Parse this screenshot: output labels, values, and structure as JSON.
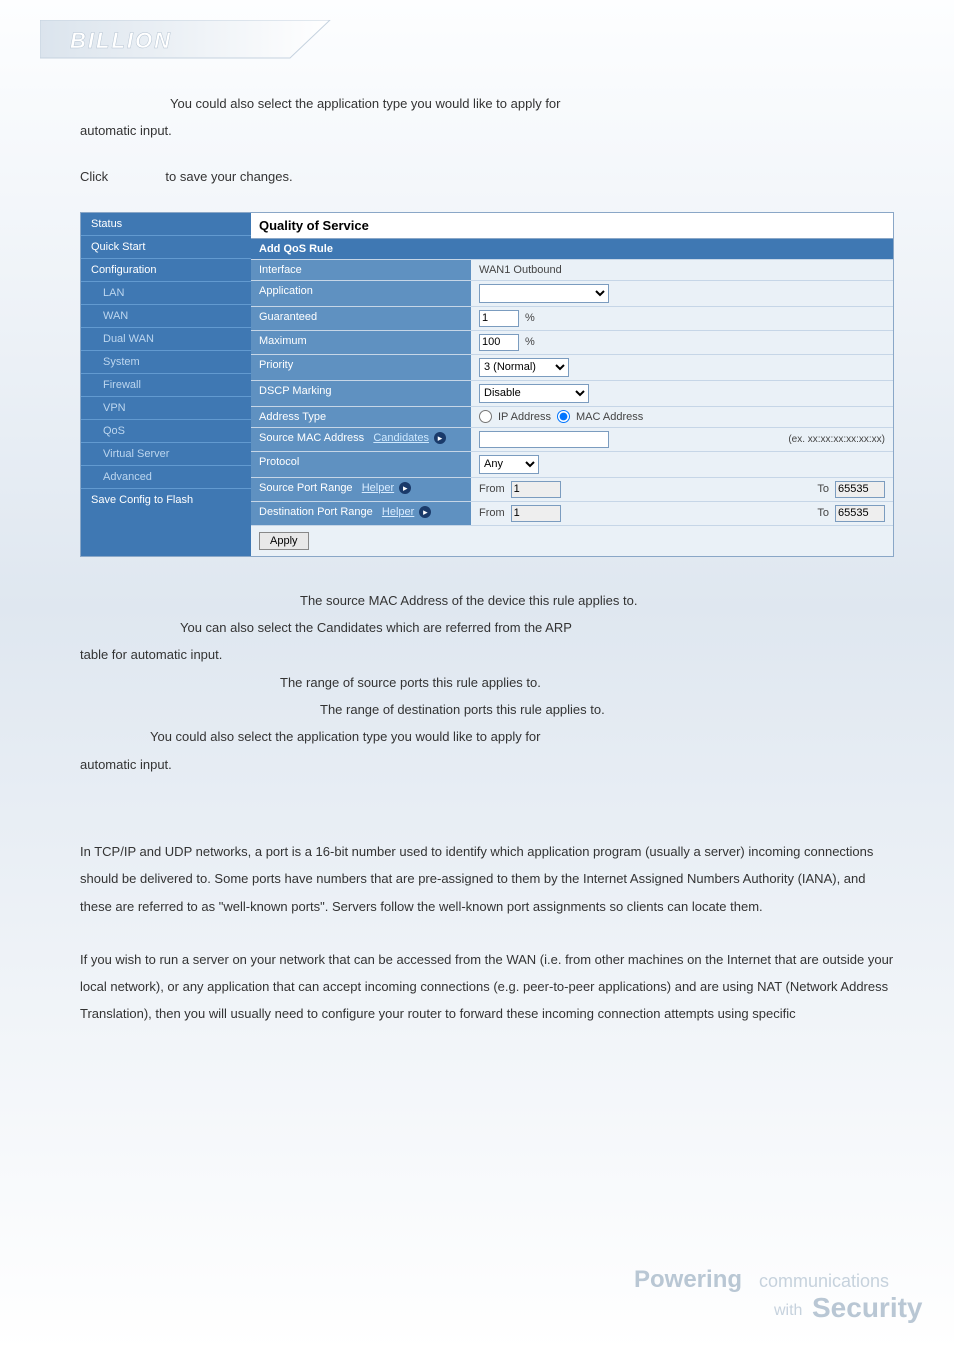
{
  "doc": {
    "helper_line1a": "You could also select the application type you would like to apply for",
    "helper_line1b": "automatic input.",
    "click_line": "Click",
    "click_line2": "to save your changes.",
    "src_mac_line": "The source MAC Address of the device this rule applies to.",
    "cand_line": "You can also select the Candidates which are referred from the ARP",
    "cand_line2": "table for automatic input.",
    "src_port_line": "The range of source ports this rule applies to.",
    "dst_port_line": "The range of destination ports this rule applies to.",
    "helper_line2a": "You could also select the application type you would like to apply for",
    "helper_line2b": "automatic input.",
    "vs_p1": "In TCP/IP and UDP networks, a port is a 16-bit number used to identify which application program (usually a server) incoming connections should be delivered to. Some ports have numbers that are pre-assigned to them by the Internet Assigned Numbers Authority (IANA), and these are referred to as \"well-known ports\". Servers follow the well-known port assignments so clients can locate them.",
    "vs_p2": "If you wish to run a server on your network that can be accessed from the WAN (i.e. from other machines on the Internet that are outside your local network), or any application that can accept incoming connections (e.g. peer-to-peer applications) and are using NAT (Network Address Translation), then you will usually need to configure your router to forward these incoming connection attempts using specific"
  },
  "panel": {
    "title": "Quality of Service",
    "subtitle": "Add QoS Rule",
    "side": {
      "status": "Status",
      "quickstart": "Quick Start",
      "configuration": "Configuration",
      "lan": "LAN",
      "wan": "WAN",
      "dualwan": "Dual WAN",
      "system": "System",
      "firewall": "Firewall",
      "vpn": "VPN",
      "qos": "QoS",
      "virtualserver": "Virtual Server",
      "advanced": "Advanced",
      "saveconfig": "Save Config to Flash"
    },
    "rows": {
      "interface": {
        "label": "Interface",
        "value": "WAN1 Outbound"
      },
      "application": {
        "label": "Application"
      },
      "guaranteed": {
        "label": "Guaranteed",
        "unit": "%",
        "value": "1"
      },
      "maximum": {
        "label": "Maximum",
        "unit": "%",
        "value": "100"
      },
      "priority": {
        "label": "Priority",
        "option": "3 (Normal)"
      },
      "dscp": {
        "label": "DSCP Marking",
        "option": "Disable"
      },
      "addrtype": {
        "label": "Address Type",
        "ip": "IP Address",
        "mac": "MAC Address"
      },
      "srcmac": {
        "label": "Source MAC Address",
        "candidates": "Candidates",
        "hint": "(ex. xx:xx:xx:xx:xx:xx)"
      },
      "protocol": {
        "label": "Protocol",
        "option": "Any"
      },
      "srcport": {
        "label": "Source Port Range",
        "helper": "Helper",
        "from": "From",
        "fromv": "1",
        "to": "To",
        "tov": "65535"
      },
      "dstport": {
        "label": "Destination Port Range",
        "helper": "Helper",
        "from": "From",
        "fromv": "1",
        "to": "To",
        "tov": "65535"
      }
    },
    "apply": "Apply"
  },
  "footer": {
    "word1": "Powering",
    "word2": "communications",
    "word3": "with",
    "word4": "Security"
  }
}
